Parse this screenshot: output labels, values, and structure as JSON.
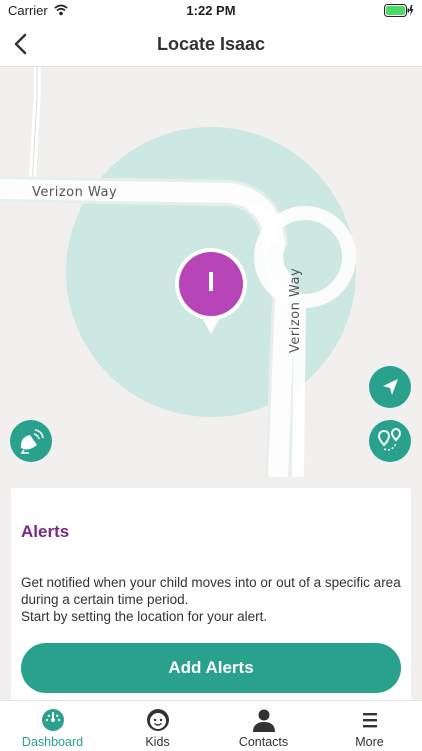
{
  "status_bar": {
    "carrier": "Carrier",
    "time": "1:22 PM",
    "battery_level": 1.0
  },
  "header": {
    "back_icon": "chevron-left-icon",
    "title": "Locate Isaac"
  },
  "map": {
    "road_labels": [
      "Verizon Way",
      "Verizon Way"
    ],
    "pin_initial": "I",
    "pin_color": "#b845b8",
    "geofence_color": "#cde8e2",
    "buttons": {
      "navigate_icon": "navigation-arrow-icon",
      "geofence_icon": "location-route-icon",
      "signal_icon": "satellite-dish-icon"
    }
  },
  "alerts": {
    "title": "Alerts",
    "description_lines": [
      "Get notified when your child moves into or out of a specific area",
      "during a certain time period.",
      "Start by setting the location for your alert."
    ],
    "button_label": "Add Alerts"
  },
  "colors": {
    "accent": "#2aa18c",
    "title_purple": "#7a2a85"
  },
  "tabs": [
    {
      "label": "Dashboard",
      "icon": "dashboard-gauge-icon",
      "active": true
    },
    {
      "label": "Kids",
      "icon": "kid-face-icon",
      "active": false
    },
    {
      "label": "Contacts",
      "icon": "person-icon",
      "active": false
    },
    {
      "label": "More",
      "icon": "menu-icon",
      "active": false
    }
  ]
}
